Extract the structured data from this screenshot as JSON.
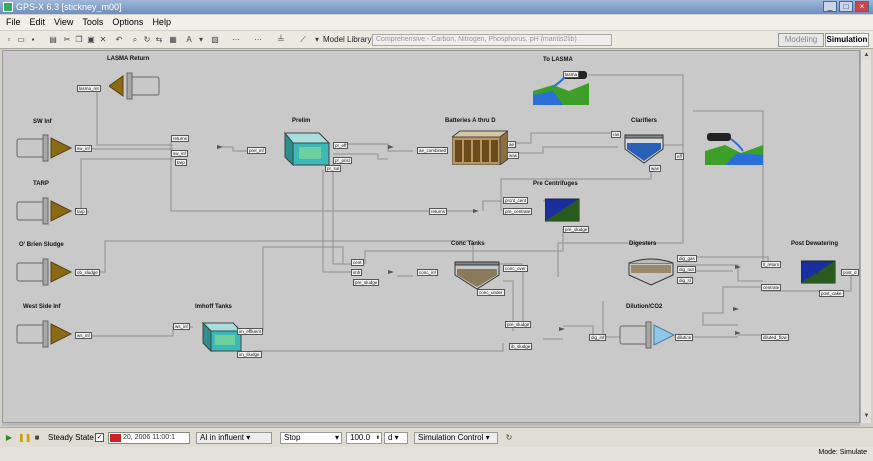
{
  "window": {
    "title": "GPS-X 6.3 [stickney_m00]"
  },
  "menu": [
    "File",
    "Edit",
    "View",
    "Tools",
    "Options",
    "Help"
  ],
  "toolbar": {
    "model_library_label": "Model Library:",
    "model_library_value": "Comprehensive - Carbon, Nitrogen, Phosphorus, pH (mantis2lib)",
    "mode_tabs": [
      "Modeling",
      "Simulation"
    ],
    "active_mode": "Simulation"
  },
  "labels": {
    "lasma_return": "LASMA Return",
    "to_lasma": "To LASMA",
    "sw_inf": "SW Inf",
    "tarp": "TARP",
    "obrien_sludge": "O' Brien Sludge",
    "west_side_inf": "West Side Inf",
    "prelim": "Prelim",
    "batteries": "Batteries A thru D",
    "clarifiers": "Clarifiers",
    "pre_centrifuges": "Pre Centrifuges",
    "conc_tanks": "Conc Tanks",
    "digesters": "Digesters",
    "post_dewatering": "Post Dewatering",
    "imhoff_tanks": "Imhoff Tanks",
    "dilution_co2": "Dilution/CO2"
  },
  "ports": {
    "lasma_return_out": "lasma_ret",
    "to_lasma_in": "lasma",
    "sw_inf_out": "sw_inf",
    "tarp_out": "tarp",
    "obrien_out": "ob_sludge",
    "west_out": "ws_inf",
    "c1_a": "returns",
    "c1_b": "sw_inf",
    "c1_c": "tarp",
    "c1_out": "prel_inf",
    "prelim_eff": "pr_eff",
    "prelim_pri": "pr_prisl",
    "prelim_sol": "pr_sol",
    "batt_in": "ae_combined",
    "batt_a": "ae",
    "batt_b": "was",
    "clar_a": "ras",
    "clar_b": "eff",
    "clar_c": "was",
    "precent_a": "prcnt_cent",
    "precent_b": "pre_centrate",
    "precent_sludge": "pre_sludge",
    "returns_mix": "returns",
    "conc_a": "cent",
    "conc_b": "imh",
    "conc_c": "pre_sludge",
    "conc_in": "conc_inf",
    "conc_out_a": "conc_over",
    "conc_out_b": "conc_under",
    "dig_a": "dig_gas",
    "dig_b": "dig_out",
    "dig_c": "dig_sl",
    "post_in": "ll_return",
    "post_cent": "centrate",
    "post_out": "post_d",
    "post_cake": "post_cake",
    "imhoff_in": "ws_inf",
    "imhoff_eff": "im_effluent",
    "imhoff_sl": "im_sludge",
    "mix_a": "pre_sludge",
    "mix_b": "ib_sludge",
    "dig_inf": "dig_inf",
    "dil_in": "dilution",
    "dil_out": "diluted_flow"
  },
  "bottom": {
    "steady_state": "Steady State",
    "date": "20, 2006  11:00:1",
    "ai_influent": "AI in influent",
    "stop": "Stop",
    "value": "100.0",
    "unit": "d",
    "sim_control": "Simulation Control"
  },
  "status": {
    "mode_text": "Mode: Simulate"
  },
  "colors": {
    "canvas": "#c9c9c9",
    "pipe": "#8f8f8f",
    "arrow": "#8a6a16",
    "tank_teal": "#3cb8b8",
    "water_blue": "#2a6fd8",
    "grass": "#3d9e2a"
  }
}
